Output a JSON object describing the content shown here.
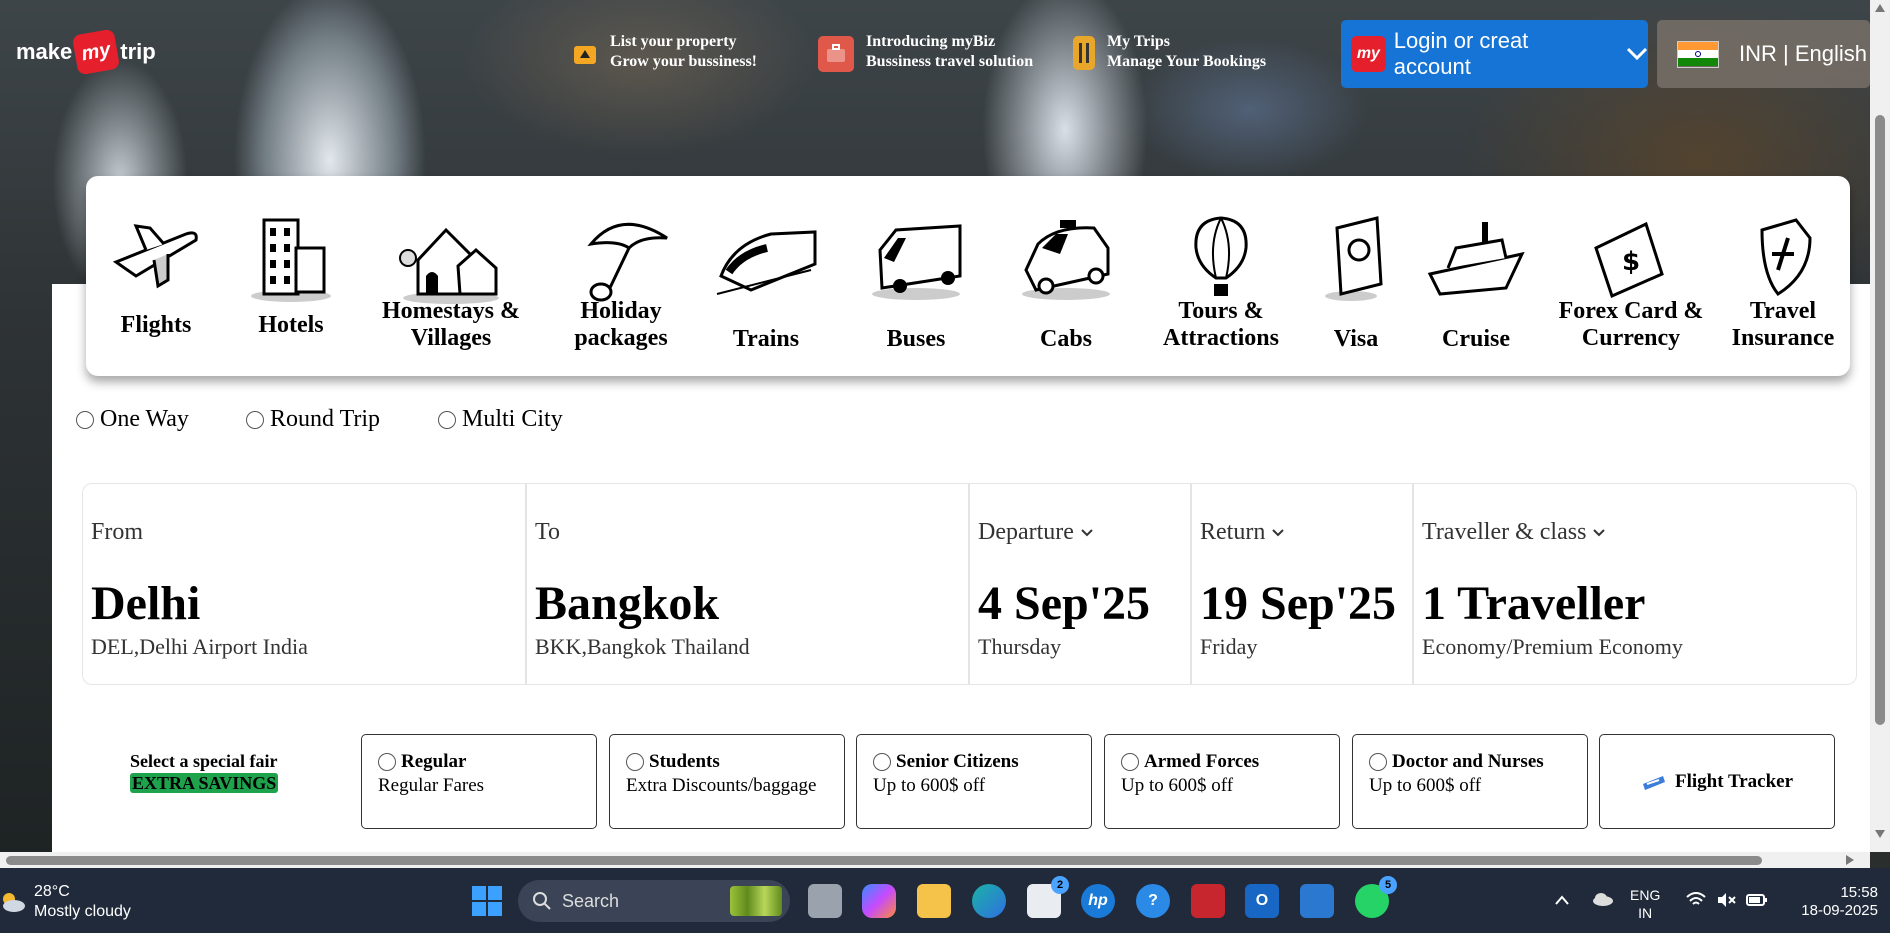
{
  "header": {
    "logo": {
      "pre": "make",
      "mid": "my",
      "post": "trip"
    },
    "top_items": [
      {
        "title": "List your property",
        "subtitle": "Grow your bussiness!",
        "icon": "property-icon"
      },
      {
        "title": "Introducing myBiz",
        "subtitle": "Bussiness travel solution",
        "icon": "briefcase-icon"
      },
      {
        "title": "My Trips",
        "subtitle": "Manage Your Bookings",
        "icon": "luggage-icon"
      }
    ],
    "login_label": "Login or creat account",
    "currency_label": "INR | English"
  },
  "nav": [
    {
      "label": "Flights",
      "icon": "plane-icon"
    },
    {
      "label": "Hotels",
      "icon": "hotel-icon"
    },
    {
      "label": "Homestays & Villages",
      "icon": "home-icon"
    },
    {
      "label": "Holiday packages",
      "icon": "umbrella-icon"
    },
    {
      "label": "Trains",
      "icon": "train-icon"
    },
    {
      "label": "Buses",
      "icon": "bus-icon"
    },
    {
      "label": "Cabs",
      "icon": "cab-icon"
    },
    {
      "label": "Tours & Attractions",
      "icon": "balloon-icon"
    },
    {
      "label": "Visa",
      "icon": "passport-icon"
    },
    {
      "label": "Cruise",
      "icon": "ship-icon"
    },
    {
      "label": "Forex Card & Currency",
      "icon": "money-icon"
    },
    {
      "label": "Travel Insurance",
      "icon": "shield-icon"
    }
  ],
  "trip_types": [
    "One Way",
    "Round Trip",
    "Multi City"
  ],
  "search": {
    "from": {
      "label": "From",
      "value": "Delhi",
      "sub": "DEL,Delhi Airport India"
    },
    "to": {
      "label": "To",
      "value": "Bangkok",
      "sub": "BKK,Bangkok Thailand"
    },
    "departure": {
      "label": "Departure",
      "value": "4 Sep'25",
      "sub": "Thursday"
    },
    "return": {
      "label": "Return",
      "value": "19 Sep'25",
      "sub": "Friday"
    },
    "traveller": {
      "label": "Traveller & class",
      "value": "1 Traveller",
      "sub": "Economy/Premium Economy"
    }
  },
  "special": {
    "title": "Select a special fair",
    "highlight": "EXTRA SAVINGS",
    "fares": [
      {
        "title": "Regular",
        "sub": "Regular Fares"
      },
      {
        "title": "Students",
        "sub": "Extra Discounts/baggage"
      },
      {
        "title": "Senior Citizens",
        "sub": "Up to 600$ off"
      },
      {
        "title": "Armed Forces",
        "sub": "Up to 600$ off"
      },
      {
        "title": "Doctor and Nurses",
        "sub": "Up to 600$ off"
      }
    ],
    "tracker": "Flight Tracker"
  },
  "taskbar": {
    "temp": "28°C",
    "weather": "Mostly cloudy",
    "search_placeholder": "Search",
    "lang_top": "ENG",
    "lang_bottom": "IN",
    "time": "15:58",
    "date": "18-09-2025",
    "badges": {
      "store": "2",
      "whatsapp": "5"
    }
  },
  "colors": {
    "accent": "#1574d6",
    "brand": "#e5202c",
    "savings": "#1ea24b"
  }
}
